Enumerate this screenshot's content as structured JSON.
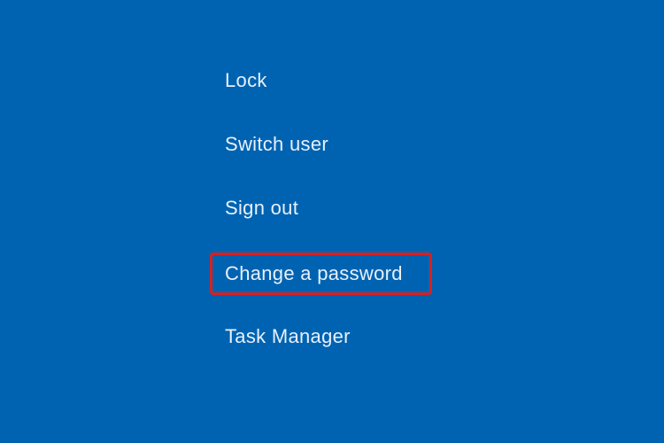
{
  "menu": {
    "items": [
      {
        "label": "Lock",
        "highlighted": false
      },
      {
        "label": "Switch user",
        "highlighted": false
      },
      {
        "label": "Sign out",
        "highlighted": false
      },
      {
        "label": "Change a password",
        "highlighted": true
      },
      {
        "label": "Task Manager",
        "highlighted": false
      }
    ]
  },
  "colors": {
    "background": "#0063b1",
    "text": "#e8f0fa",
    "highlight_border": "#d92020"
  }
}
